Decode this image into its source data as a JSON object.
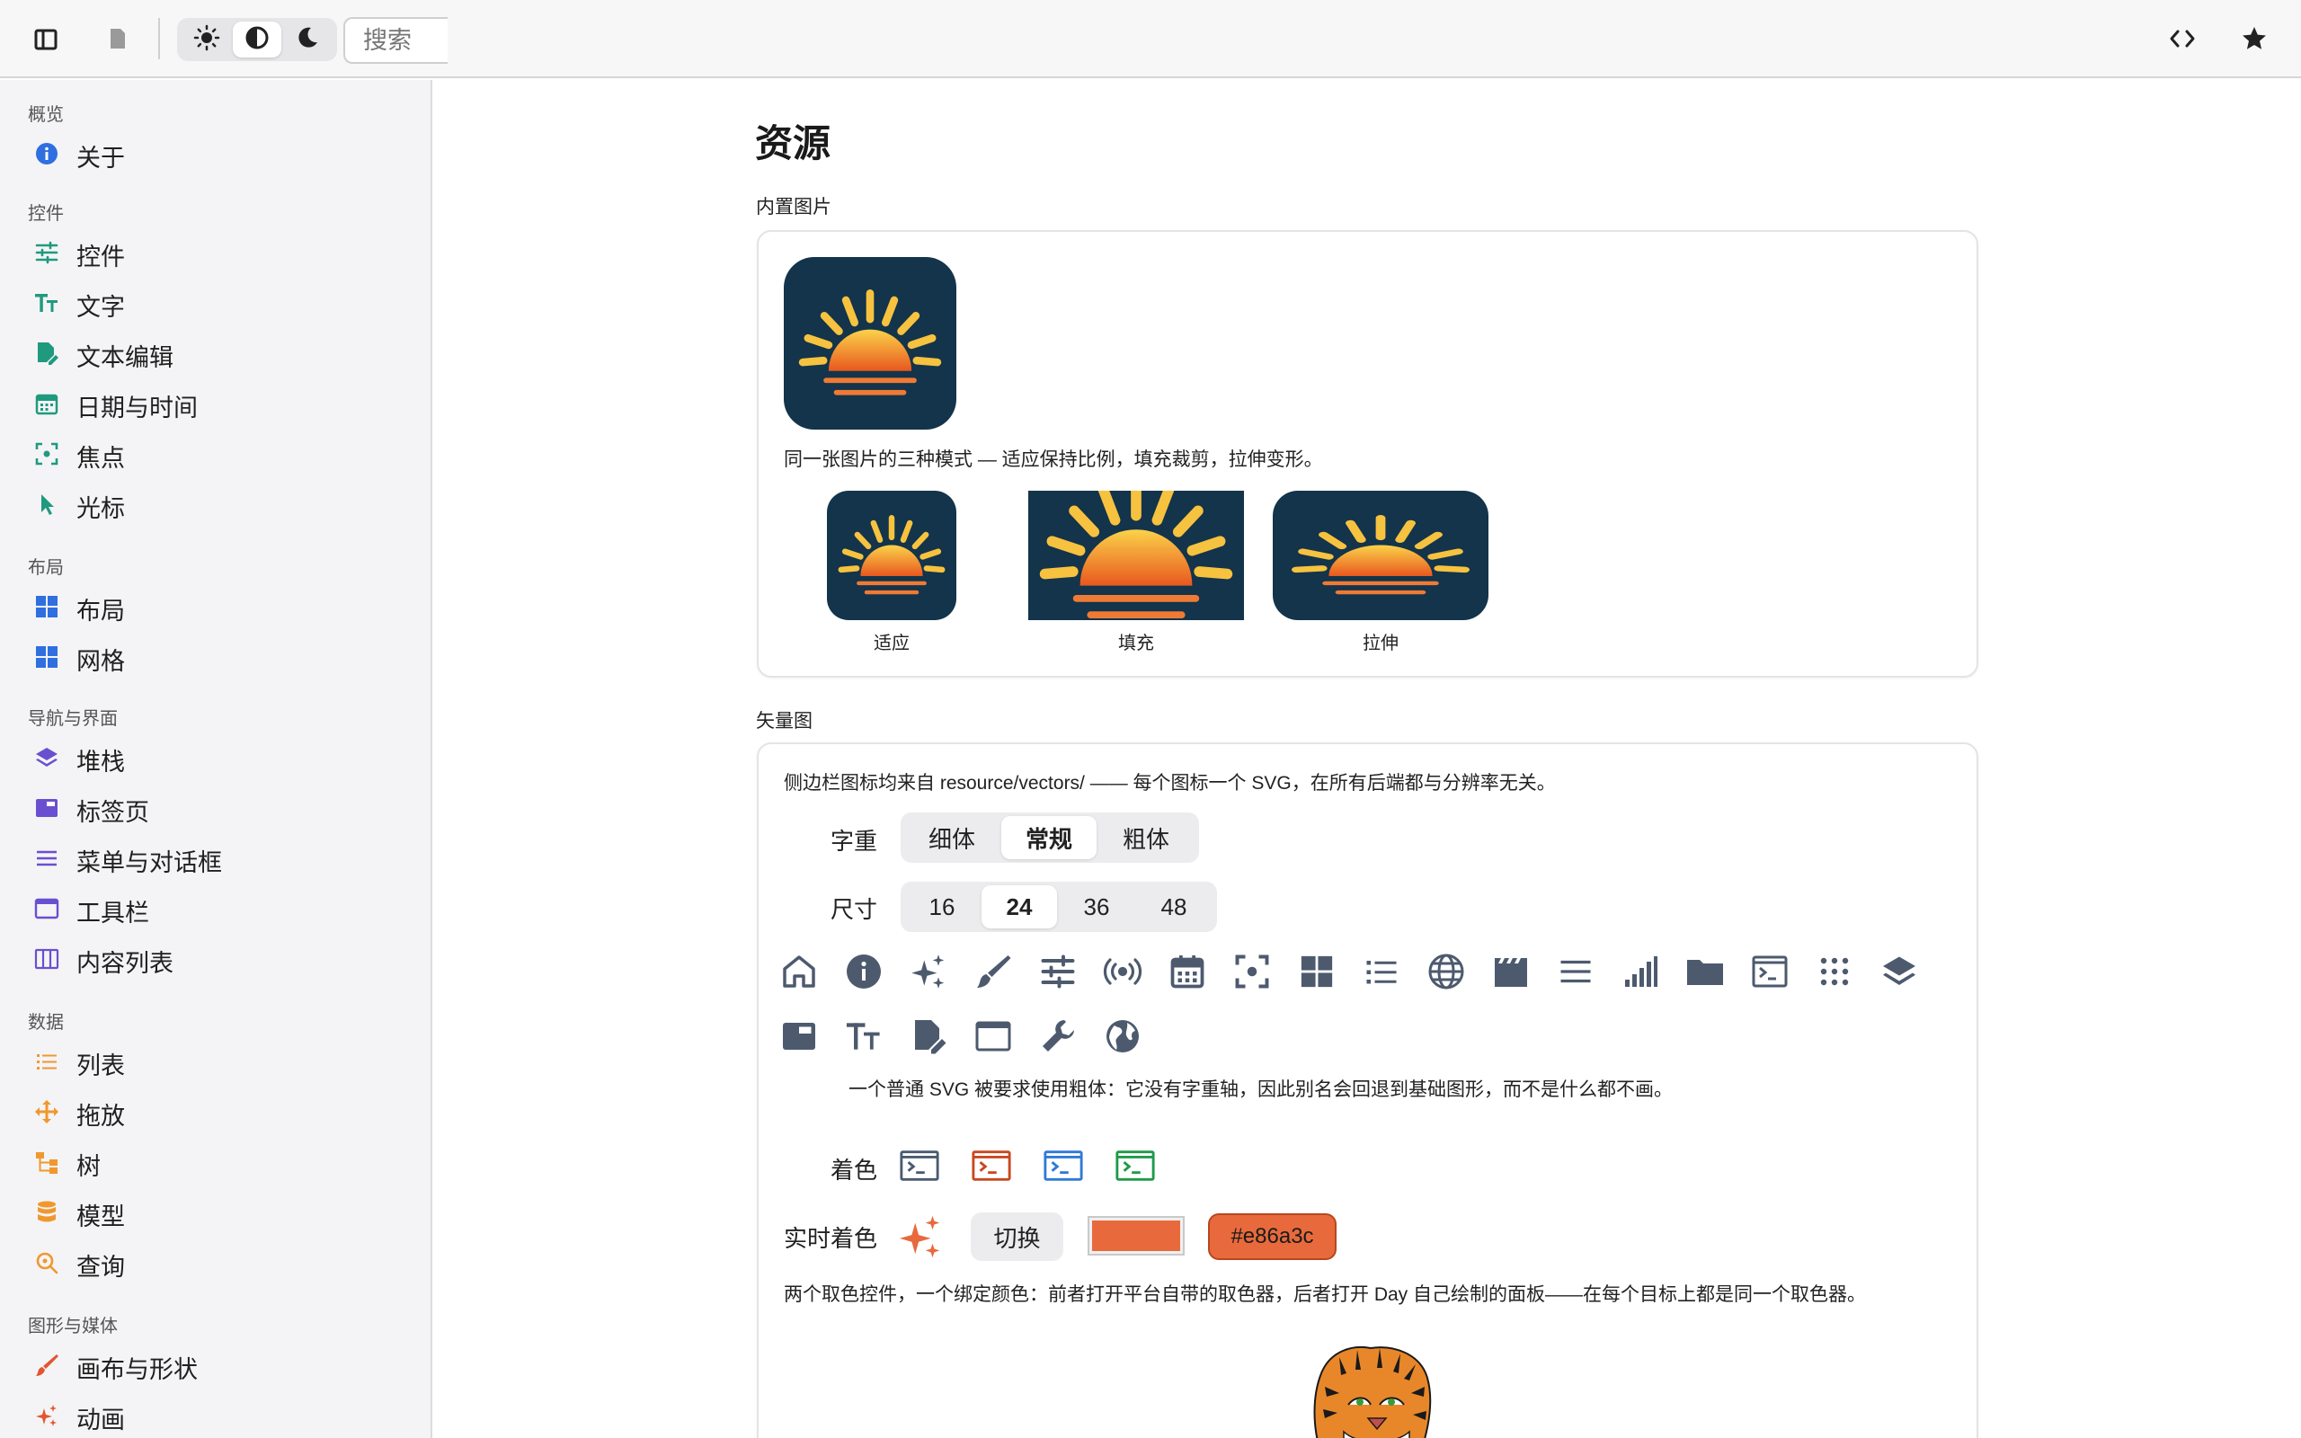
{
  "topbar": {
    "search_placeholder": "搜索",
    "icons": [
      "sidebar-icon",
      "document-icon",
      "sun-icon",
      "contrast-icon",
      "moon-icon",
      "code-icon",
      "star-icon"
    ]
  },
  "sidebar": {
    "sections": [
      {
        "title": "概览",
        "items": [
          {
            "label": "关于",
            "icon": "info-icon"
          }
        ]
      },
      {
        "title": "控件",
        "items": [
          {
            "label": "控件",
            "icon": "sliders-icon"
          },
          {
            "label": "文字",
            "icon": "text-size-icon"
          },
          {
            "label": "文本编辑",
            "icon": "edit-document-icon"
          },
          {
            "label": "日期与时间",
            "icon": "calendar-icon"
          },
          {
            "label": "焦点",
            "icon": "focus-icon"
          },
          {
            "label": "光标",
            "icon": "cursor-icon"
          }
        ]
      },
      {
        "title": "布局",
        "items": [
          {
            "label": "布局",
            "icon": "grid-icon"
          },
          {
            "label": "网格",
            "icon": "grid-icon"
          }
        ]
      },
      {
        "title": "导航与界面",
        "items": [
          {
            "label": "堆栈",
            "icon": "layers-icon"
          },
          {
            "label": "标签页",
            "icon": "tab-icon"
          },
          {
            "label": "菜单与对话框",
            "icon": "menu-icon"
          },
          {
            "label": "工具栏",
            "icon": "window-icon"
          },
          {
            "label": "内容列表",
            "icon": "columns-icon"
          }
        ]
      },
      {
        "title": "数据",
        "items": [
          {
            "label": "列表",
            "icon": "list-icon"
          },
          {
            "label": "拖放",
            "icon": "move-icon"
          },
          {
            "label": "树",
            "icon": "tree-icon"
          },
          {
            "label": "模型",
            "icon": "database-icon"
          },
          {
            "label": "查询",
            "icon": "search-icon"
          }
        ]
      },
      {
        "title": "图形与媒体",
        "items": [
          {
            "label": "画布与形状",
            "icon": "brush-icon"
          },
          {
            "label": "动画",
            "icon": "sparkle-icon"
          }
        ]
      }
    ]
  },
  "main": {
    "title": "资源",
    "builtin_images": {
      "heading": "内置图片",
      "description": "同一张图片的三种模式 — 适应保持比例，填充裁剪，拉伸变形。",
      "modes": [
        "适应",
        "填充",
        "拉伸"
      ]
    },
    "vectors": {
      "heading": "矢量图",
      "description": "侧边栏图标均来自 resource/vectors/ —— 每个图标一个 SVG，在所有后端都与分辨率无关。",
      "weight_label": "字重",
      "weights": [
        "细体",
        "常规",
        "粗体"
      ],
      "weight_selected": "常规",
      "size_label": "尺寸",
      "sizes": [
        "16",
        "24",
        "36",
        "48"
      ],
      "size_selected": "24",
      "note": "一个普通 SVG 被要求使用粗体：它没有字重轴，因此别名会回退到基础图形，而不是什么都不画。",
      "tint_label": "着色",
      "tint_colors": [
        "#4a5a70",
        "#c8481e",
        "#2f7ad6",
        "#1f9a4a"
      ],
      "live_tint_label": "实时着色",
      "switch_label": "切换",
      "color_value": "#e86a3c",
      "picker_note": "两个取色控件，一个绑定颜色：前者打开平台自带的取色器，后者打开 Day 自己绘制的面板——在每个目标上都是同一个取色器。"
    }
  },
  "colors": {
    "icon_slate": "#4d5a6e",
    "accent_orange": "#e86a3c",
    "navy": "#13344a"
  }
}
